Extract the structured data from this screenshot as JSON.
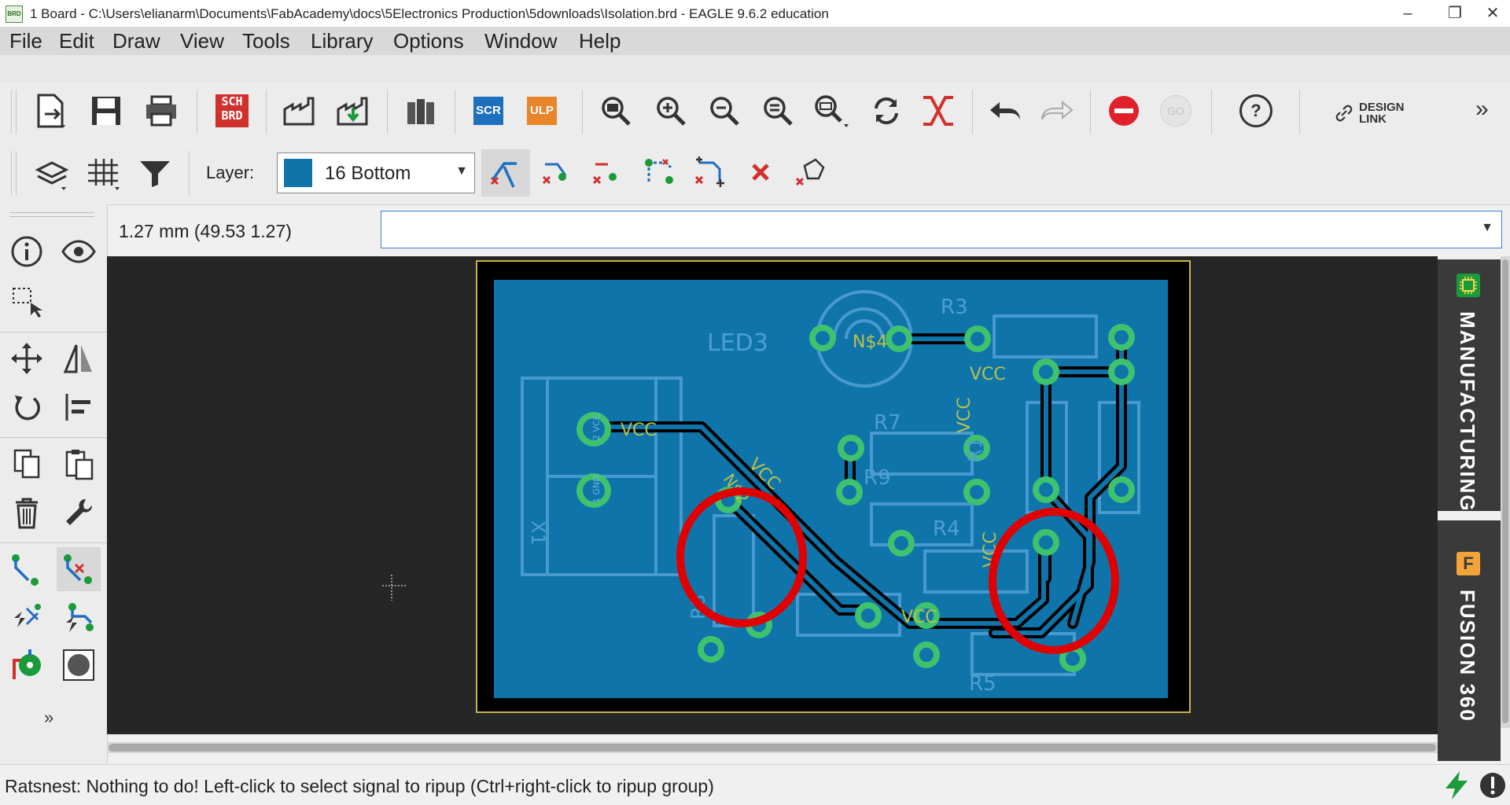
{
  "window": {
    "title": "1 Board - C:\\Users\\elianarm\\Documents\\FabAcademy\\docs\\5Electronics Production\\5downloads\\Isolation.brd - EAGLE 9.6.2 education",
    "app_icon_text": "BRD"
  },
  "menu": [
    "File",
    "Edit",
    "Draw",
    "View",
    "Tools",
    "Library",
    "Options",
    "Window",
    "Help"
  ],
  "toolbar": {
    "sch_brd_label_top": "SCH",
    "sch_brd_label_bottom": "BRD",
    "scr_label": "SCR",
    "ulp_label": "ULP",
    "go_label": "GO",
    "help_label": "?",
    "design_link_line1": "DESIGN",
    "design_link_line2": "LINK",
    "more": "»"
  },
  "layer": {
    "label": "Layer:",
    "selected": "16 Bottom",
    "swatch_color": "#0f74aa"
  },
  "coordinates": "1.27 mm (49.53 1.27)",
  "command_input": {
    "value": ""
  },
  "side_tabs": {
    "manufacturing": "MANUFACTURING",
    "fusion": "FUSION 360"
  },
  "board_labels": {
    "led": "LED3",
    "r3": "R3",
    "ns4": "N$4",
    "vcc_top": "VCC",
    "vcc_conn": "VCC",
    "vcc_vertical": "VCC",
    "r7": "R7",
    "r9": "R9",
    "r1": "R1",
    "r4": "R4",
    "r8": "R8",
    "r5": "R5",
    "x1": "X1",
    "vcc_bottom": "VCC",
    "vcc_right": "VCC",
    "ns2": "N$2",
    "vcc_diag": "VCC",
    "pin_2": "2 VCC",
    "pin_1": "1 GND"
  },
  "colors": {
    "board_fill": "#0f74aa",
    "board_outline": "#c9b34a",
    "pads": "#3fc26e",
    "highlight": "#e00000",
    "canvas": "#262626"
  },
  "status": {
    "message": "Ratsnest: Nothing to do! Left-click to select signal to ripup (Ctrl+right-click to ripup group)"
  }
}
